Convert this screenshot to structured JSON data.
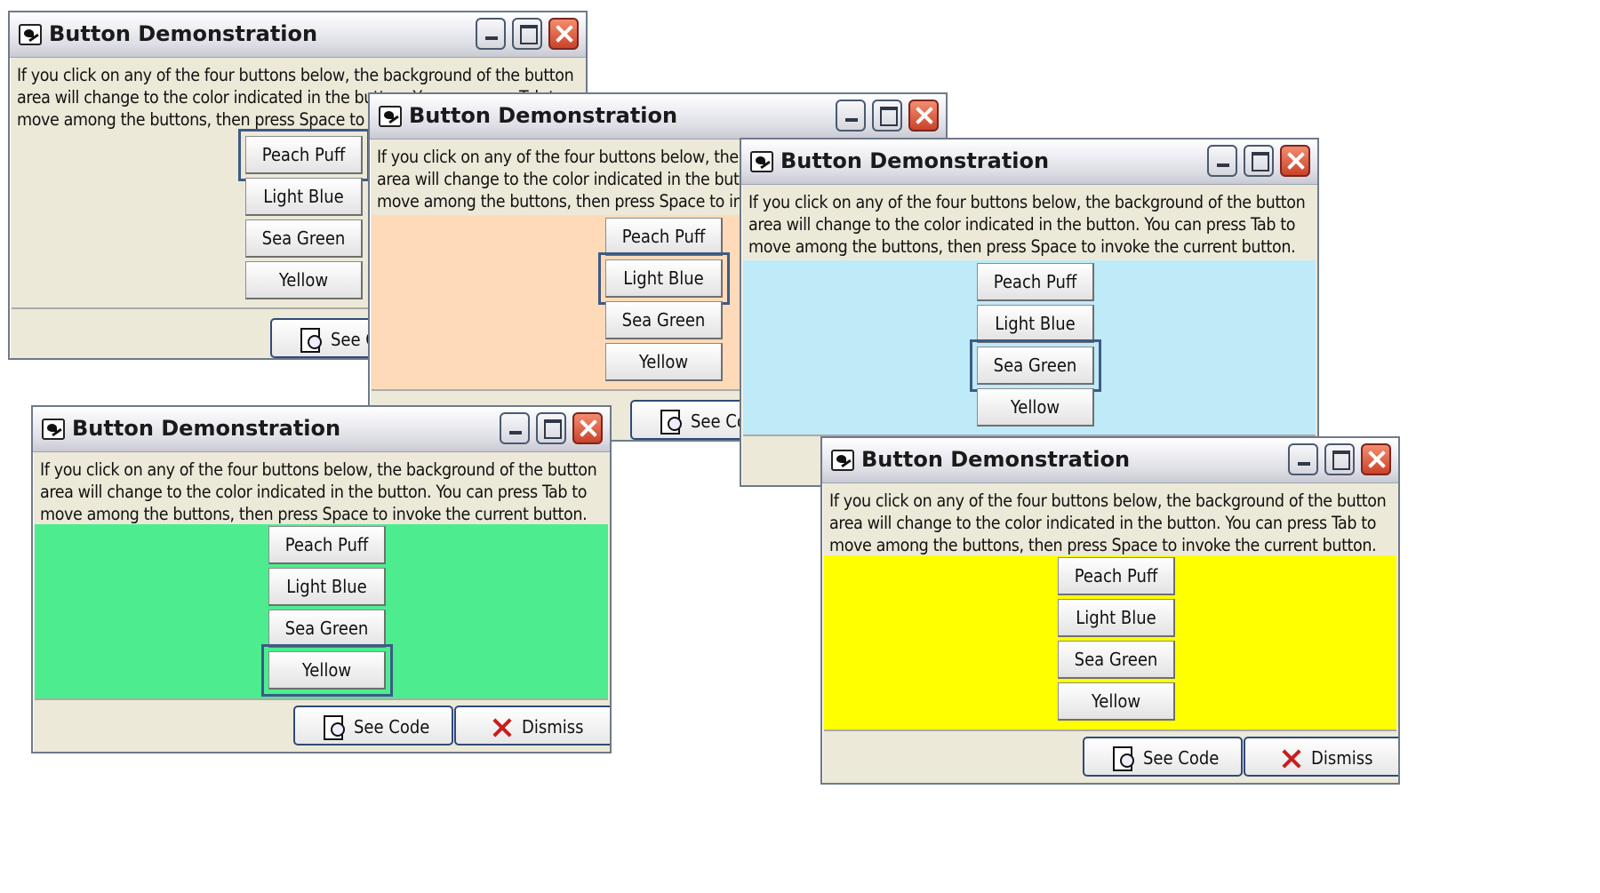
{
  "windows": [
    {
      "id": "w1",
      "title": "Button Demonstration",
      "area_color": "#ece9d8",
      "focused_button": "peach-puff-button",
      "description": [
        "If you click on any of the four buttons below, the background of the button",
        "area will change to the color indicated in the button.  You can press Tab to",
        "move among the buttons, then press Space to invoke the current button."
      ]
    },
    {
      "id": "w2",
      "title": "Button Demonstration",
      "area_color": "#ffdab9",
      "focused_button": "light-blue-button",
      "description": [
        "If you click on any of the four buttons below, the background of the button",
        "area will change to the color indicated in the button.  You can press Tab to",
        "move among the buttons, then press Space to invoke the current button."
      ]
    },
    {
      "id": "w3",
      "title": "Button Demonstration",
      "area_color": "#bfeaf8",
      "focused_button": "sea-green-button",
      "description": [
        "If you click on any of the four buttons below, the background of the button",
        "area will change to the color indicated in the button.  You can press Tab to",
        "move among the buttons, then press Space to invoke the current button."
      ]
    },
    {
      "id": "w4",
      "title": "Button Demonstration",
      "area_color": "#4ded8f",
      "focused_button": "yellow-button",
      "description": [
        "If you click on any of the four buttons below, the background of the button",
        "area will change to the color indicated in the button.  You can press Tab to",
        "move among the buttons, then press Space to invoke the current button."
      ]
    },
    {
      "id": "w5",
      "title": "Button Demonstration",
      "area_color": "#ffff00",
      "focused_button": null,
      "description": [
        "If you click on any of the four buttons below, the background of the button",
        "area will change to the color indicated in the button.  You can press Tab to",
        "move among the buttons, then press Space to invoke the current button."
      ]
    }
  ],
  "color_buttons": [
    "Peach Puff",
    "Light Blue",
    "Sea Green",
    "Yellow"
  ],
  "footer": {
    "see_code_label": "See Code",
    "dismiss_label": "Dismiss"
  },
  "icons": {
    "app": "app-icon",
    "minimize": "minimize-icon",
    "maximize": "maximize-icon",
    "close": "close-icon",
    "see_code": "document-magnifier-icon",
    "dismiss": "x-icon"
  }
}
